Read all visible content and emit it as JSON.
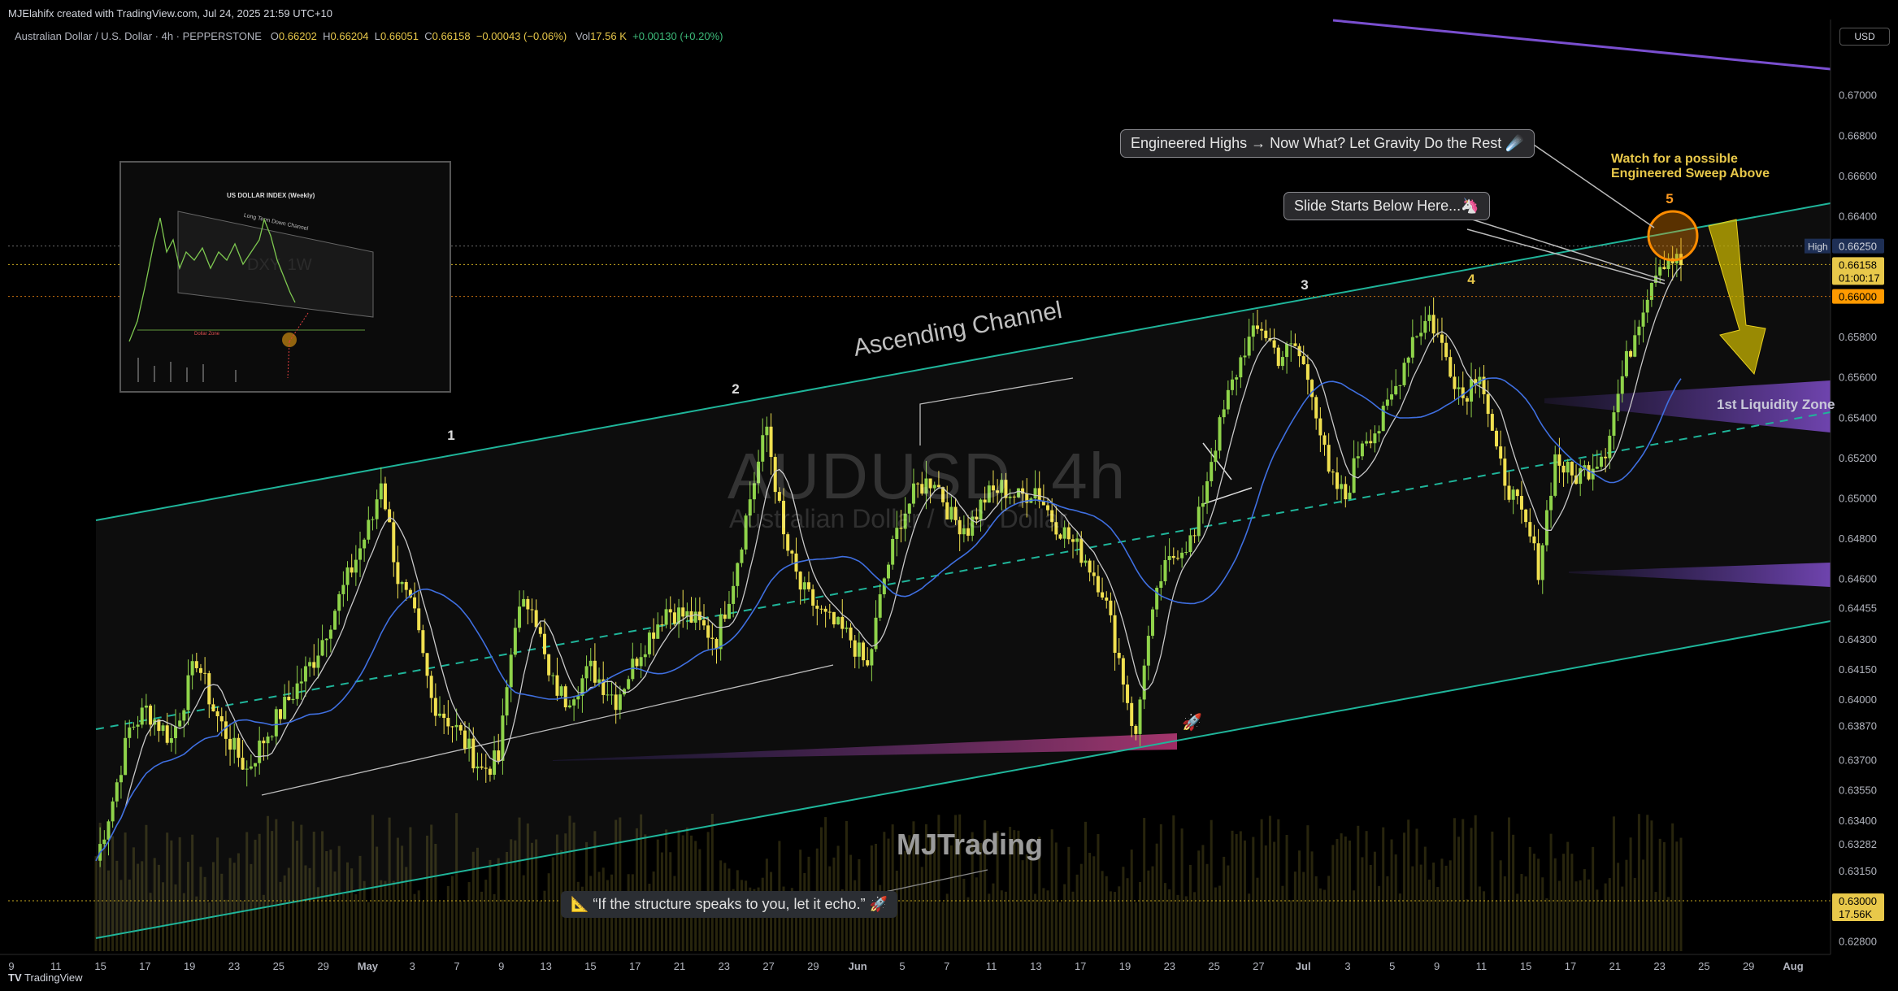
{
  "credit": "MJElahifx created with TradingView.com, Jul 24, 2025 21:59 UTC+10",
  "symbol_line": {
    "name": "Australian Dollar / U.S. Dollar · 4h · PEPPERSTONE",
    "o_label": "O",
    "o": "0.66202",
    "h_label": "H",
    "h": "0.66204",
    "l_label": "L",
    "l": "0.66051",
    "c_label": "C",
    "c": "0.66158",
    "change": "−0.00043 (−0.06%)",
    "vol_label": "Vol",
    "vol": "17.56 K",
    "vol_change": "+0.00130 (+0.20%)"
  },
  "currency_button": "USD",
  "annotations": {
    "callout_top": "Engineered Highs → Now What? Let Gravity Do the Rest ☄️",
    "callout_slide": "Slide Starts Below Here...🦄",
    "watch_line1": "Watch for a possible",
    "watch_line2": "Engineered Sweep Above",
    "channel_label": "Ascending Channel",
    "liquidity_label": "1st Liquidity Zone",
    "brand": "MJTrading",
    "quote": "📐 “If the structure speaks to you, let it echo.” 🚀",
    "rocket": "🚀"
  },
  "watermark": {
    "symbol": "AUDUSD, 4h",
    "name": "Australian Dollar / U.S. Dollar"
  },
  "inset": {
    "title": "US DOLLAR INDEX (Weekly)",
    "channel": "Long Term Down Channel",
    "zone": "Dollar Zone",
    "ticker": "DXY, 1W"
  },
  "footer": {
    "logo": "TradingView"
  },
  "colors": {
    "bull": "#8fd34a",
    "bear": "#f0e050",
    "channel": "#1fb59a",
    "sma": "#c8c8c8",
    "ema": "#3f6fe0",
    "zone": "#7a44c8",
    "highlight": "#ff8c00",
    "arrow": "#c8b400"
  },
  "chart_data": {
    "type": "candlestick",
    "timeframe": "4h",
    "y_axis": {
      "ylim": [
        0.6275,
        0.6735
      ],
      "ticks": [
        "0.67000",
        "0.66800",
        "0.66600",
        "0.66400",
        "0.66250",
        "0.66158",
        "0.66000",
        "0.65800",
        "0.65600",
        "0.65400",
        "0.65200",
        "0.65000",
        "0.64800",
        "0.64600",
        "0.64455",
        "0.64300",
        "0.64150",
        "0.64000",
        "0.63870",
        "0.63700",
        "0.63550",
        "0.63400",
        "0.63282",
        "0.63150",
        "0.63000",
        "0.62800"
      ],
      "tick_values": [
        0.67,
        0.668,
        0.666,
        0.664,
        0.6625,
        0.66158,
        0.66,
        0.658,
        0.656,
        0.654,
        0.652,
        0.65,
        0.648,
        0.646,
        0.64455,
        0.643,
        0.6415,
        0.64,
        0.6387,
        0.637,
        0.6355,
        0.634,
        0.63282,
        0.6315,
        0.63,
        0.628
      ],
      "badges": [
        {
          "label": "High",
          "value": "0.66250"
        },
        {
          "value": "0.66158",
          "sub": "01:00:17"
        },
        {
          "value": "0.66000"
        },
        {
          "value": "0.63000",
          "sub": "17.56K"
        }
      ]
    },
    "x_axis": {
      "ticks": [
        "9",
        "11",
        "15",
        "17",
        "19",
        "23",
        "25",
        "29",
        "May",
        "3",
        "7",
        "9",
        "13",
        "15",
        "17",
        "21",
        "23",
        "27",
        "29",
        "Jun",
        "5",
        "7",
        "11",
        "13",
        "17",
        "19",
        "23",
        "25",
        "27",
        "Jul",
        "3",
        "5",
        "9",
        "11",
        "15",
        "17",
        "21",
        "23",
        "25",
        "29",
        "Aug"
      ],
      "bold": [
        "May",
        "Jun",
        "Jul",
        "Aug"
      ]
    },
    "waypoints": [
      {
        "t": 0,
        "p": 0.632
      },
      {
        "t": 4,
        "p": 0.635
      },
      {
        "t": 8,
        "p": 0.6385
      },
      {
        "t": 12,
        "p": 0.6395
      },
      {
        "t": 18,
        "p": 0.638
      },
      {
        "t": 24,
        "p": 0.642
      },
      {
        "t": 28,
        "p": 0.6395
      },
      {
        "t": 33,
        "p": 0.6375
      },
      {
        "t": 36,
        "p": 0.6365
      },
      {
        "t": 40,
        "p": 0.638
      },
      {
        "t": 46,
        "p": 0.64
      },
      {
        "t": 52,
        "p": 0.642
      },
      {
        "t": 58,
        "p": 0.645
      },
      {
        "t": 62,
        "p": 0.647
      },
      {
        "t": 66,
        "p": 0.649
      },
      {
        "t": 68,
        "p": 0.651
      },
      {
        "t": 72,
        "p": 0.646
      },
      {
        "t": 76,
        "p": 0.644
      },
      {
        "t": 80,
        "p": 0.64
      },
      {
        "t": 86,
        "p": 0.6385
      },
      {
        "t": 92,
        "p": 0.6365
      },
      {
        "t": 96,
        "p": 0.637
      },
      {
        "t": 100,
        "p": 0.644
      },
      {
        "t": 104,
        "p": 0.645
      },
      {
        "t": 108,
        "p": 0.641
      },
      {
        "t": 112,
        "p": 0.64
      },
      {
        "t": 118,
        "p": 0.6415
      },
      {
        "t": 124,
        "p": 0.64
      },
      {
        "t": 130,
        "p": 0.6425
      },
      {
        "t": 136,
        "p": 0.6445
      },
      {
        "t": 142,
        "p": 0.644
      },
      {
        "t": 148,
        "p": 0.643
      },
      {
        "t": 152,
        "p": 0.646
      },
      {
        "t": 156,
        "p": 0.65
      },
      {
        "t": 160,
        "p": 0.6535
      },
      {
        "t": 164,
        "p": 0.648
      },
      {
        "t": 168,
        "p": 0.6455
      },
      {
        "t": 174,
        "p": 0.644
      },
      {
        "t": 180,
        "p": 0.643
      },
      {
        "t": 184,
        "p": 0.6415
      },
      {
        "t": 188,
        "p": 0.646
      },
      {
        "t": 192,
        "p": 0.649
      },
      {
        "t": 196,
        "p": 0.6505
      },
      {
        "t": 200,
        "p": 0.651
      },
      {
        "t": 204,
        "p": 0.649
      },
      {
        "t": 208,
        "p": 0.6485
      },
      {
        "t": 212,
        "p": 0.65
      },
      {
        "t": 216,
        "p": 0.6505
      },
      {
        "t": 220,
        "p": 0.65
      },
      {
        "t": 224,
        "p": 0.6505
      },
      {
        "t": 228,
        "p": 0.649
      },
      {
        "t": 232,
        "p": 0.648
      },
      {
        "t": 236,
        "p": 0.647
      },
      {
        "t": 240,
        "p": 0.6455
      },
      {
        "t": 244,
        "p": 0.642
      },
      {
        "t": 248,
        "p": 0.638
      },
      {
        "t": 250,
        "p": 0.642
      },
      {
        "t": 254,
        "p": 0.646
      },
      {
        "t": 258,
        "p": 0.6475
      },
      {
        "t": 262,
        "p": 0.648
      },
      {
        "t": 266,
        "p": 0.652
      },
      {
        "t": 270,
        "p": 0.655
      },
      {
        "t": 274,
        "p": 0.6575
      },
      {
        "t": 278,
        "p": 0.6585
      },
      {
        "t": 282,
        "p": 0.657
      },
      {
        "t": 286,
        "p": 0.6575
      },
      {
        "t": 290,
        "p": 0.6555
      },
      {
        "t": 294,
        "p": 0.651
      },
      {
        "t": 298,
        "p": 0.65
      },
      {
        "t": 302,
        "p": 0.653
      },
      {
        "t": 306,
        "p": 0.6535
      },
      {
        "t": 310,
        "p": 0.6555
      },
      {
        "t": 314,
        "p": 0.658
      },
      {
        "t": 318,
        "p": 0.659
      },
      {
        "t": 322,
        "p": 0.657
      },
      {
        "t": 326,
        "p": 0.655
      },
      {
        "t": 330,
        "p": 0.6565
      },
      {
        "t": 334,
        "p": 0.652
      },
      {
        "t": 338,
        "p": 0.65
      },
      {
        "t": 342,
        "p": 0.648
      },
      {
        "t": 344,
        "p": 0.6465
      },
      {
        "t": 348,
        "p": 0.652
      },
      {
        "t": 352,
        "p": 0.651
      },
      {
        "t": 356,
        "p": 0.6515
      },
      {
        "t": 360,
        "p": 0.6525
      },
      {
        "t": 364,
        "p": 0.656
      },
      {
        "t": 368,
        "p": 0.659
      },
      {
        "t": 372,
        "p": 0.6615
      },
      {
        "t": 375,
        "p": 0.662
      },
      {
        "t": 378,
        "p": 0.6616
      }
    ],
    "wave_labels": [
      "1",
      "2",
      "3",
      "4",
      "5"
    ]
  }
}
